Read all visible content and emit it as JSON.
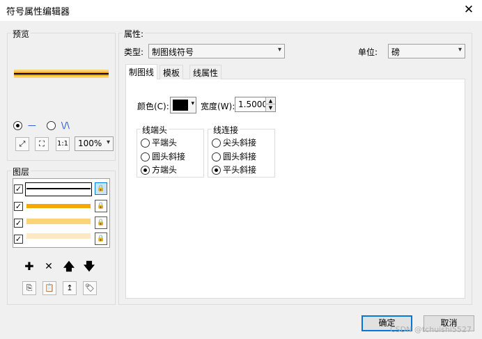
{
  "window": {
    "title": "符号属性编辑器",
    "close": "✕"
  },
  "preview": {
    "label": "预览",
    "radio_line": "—",
    "radio_zigzag": "\\/\\",
    "zoom": "100%",
    "tools": [
      "expand-icon",
      "fit-icon",
      "one-to-one-icon"
    ]
  },
  "layers": {
    "label": "图层",
    "rows": [
      {
        "checked": true,
        "color": "#000000"
      },
      {
        "checked": true,
        "color": "#f5a800"
      },
      {
        "checked": true,
        "color": "#fdd37a"
      },
      {
        "checked": true,
        "color": "#ffe8c2"
      }
    ]
  },
  "props": {
    "label": "属性:",
    "type_label": "类型:",
    "type_value": "制图线符号",
    "unit_label": "单位:",
    "unit_value": "磅",
    "tabs": [
      "制图线",
      "模板",
      "线属性"
    ],
    "color_label": "颜色(C):",
    "width_label": "宽度(W):",
    "width_value": "1.5000",
    "cap_group": "线端头",
    "caps": [
      "平端头",
      "圆头斜接",
      "方端头"
    ],
    "cap_selected": 2,
    "join_group": "线连接",
    "joins": [
      "尖头斜接",
      "圆头斜接",
      "平头斜接"
    ],
    "join_selected": 2
  },
  "buttons": {
    "ok": "确定",
    "cancel": "取消"
  },
  "watermark": "CSDN @tchuishi5527"
}
